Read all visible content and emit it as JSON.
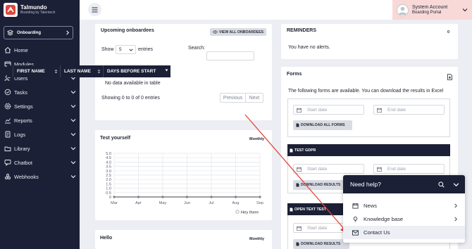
{
  "brand": {
    "title": "Talmundo",
    "subtitle": "Boarding by Talentech"
  },
  "project_select": {
    "label": "Onboarding"
  },
  "nav": [
    {
      "label": "Home",
      "icon": "home-icon",
      "has_chevron": false
    },
    {
      "label": "Modules",
      "icon": "modules-icon",
      "has_chevron": false
    },
    {
      "label": "Users",
      "icon": "users-icon",
      "has_chevron": true
    },
    {
      "label": "Tasks",
      "icon": "tasks-icon",
      "has_chevron": true
    },
    {
      "label": "Settings",
      "icon": "gear-icon",
      "has_chevron": true
    },
    {
      "label": "Reports",
      "icon": "reports-icon",
      "has_chevron": true
    },
    {
      "label": "Logs",
      "icon": "logs-icon",
      "has_chevron": true
    },
    {
      "label": "Library",
      "icon": "library-icon",
      "has_chevron": true
    },
    {
      "label": "Chatbot",
      "icon": "chatbot-icon",
      "has_chevron": true
    },
    {
      "label": "Webhooks",
      "icon": "webhooks-icon",
      "has_chevron": true
    }
  ],
  "account": {
    "name": "System Account",
    "role": "Boarding Portal"
  },
  "onboardees": {
    "title": "Upcoming onboardees",
    "view_all": "VIEW ALL ONBOARDEES",
    "show_label": "Show",
    "entries_value": "5",
    "entries_label": "entries",
    "search_label": "Search:",
    "columns": [
      "FIRST NAME",
      "LAST NAME",
      "DAYS BEFORE START"
    ],
    "empty": "No data available in table",
    "info": "Showing 0 to 0 of 0 entries",
    "prev": "Previous",
    "next": "Next"
  },
  "test_yourself": {
    "title": "Test yourself",
    "period": "Monthly",
    "legend": "Hey there"
  },
  "hello": {
    "title": "Hello",
    "period": "Monthly"
  },
  "reminders": {
    "title": "REMINDERS",
    "count": "0",
    "empty": "You have no alerts."
  },
  "forms": {
    "title": "Forms",
    "description": "The following forms are available. You can download the results in Excel",
    "start_placeholder": "Start date",
    "end_placeholder": "End date",
    "download_all": "DOWNLOAD ALL FORMS",
    "blocks": [
      {
        "title": "TEST GDPR",
        "download": "DOWNLOAD RESULTS"
      },
      {
        "title": "OPEN TEXT TEST",
        "download": "DOWNLOAD RESULTS"
      }
    ]
  },
  "help": {
    "title": "Need help?",
    "items": [
      {
        "label": "News",
        "icon": "calendar-icon"
      },
      {
        "label": "Knowledge base",
        "icon": "lightbulb-icon"
      },
      {
        "label": "Contact Us",
        "icon": "envelope-icon"
      }
    ]
  },
  "colors": {
    "sidebar": "#1c2036",
    "account_bg": "#f8d9d8",
    "arrow": "#e0463c",
    "line": "#808080"
  },
  "chart_data": {
    "type": "line",
    "categories": [
      "Mar",
      "Apr",
      "May",
      "Jun",
      "Jul",
      "Aug",
      "Sep"
    ],
    "series": [
      {
        "name": "Hey there",
        "values": [
          0,
          0,
          0,
          0,
          0,
          0,
          0
        ]
      }
    ],
    "yticks": [
      "5.0",
      "4.5",
      "4.0",
      "3.5",
      "3.0",
      "2.5",
      "2.0",
      "1.5",
      "1.0",
      "0.5",
      "0"
    ],
    "ylim": [
      0,
      5
    ],
    "grid": true,
    "legend": "bottom-right"
  }
}
